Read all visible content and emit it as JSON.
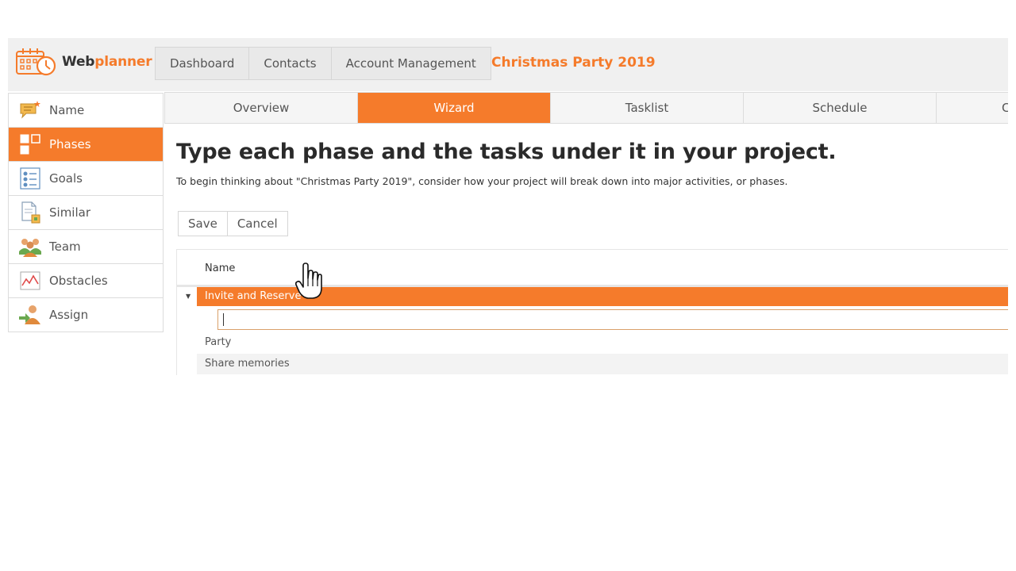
{
  "logo": {
    "text_part1": "Web",
    "text_part2": "planner"
  },
  "topnav": [
    "Dashboard",
    "Contacts",
    "Account Management"
  ],
  "project_title": "Christmas Party 2019",
  "sidebar": {
    "items": [
      {
        "label": "Name",
        "icon": "name-icon"
      },
      {
        "label": "Phases",
        "icon": "phases-icon",
        "active": true
      },
      {
        "label": "Goals",
        "icon": "goals-icon"
      },
      {
        "label": "Similar",
        "icon": "similar-icon"
      },
      {
        "label": "Team",
        "icon": "team-icon"
      },
      {
        "label": "Obstacles",
        "icon": "obstacles-icon"
      },
      {
        "label": "Assign",
        "icon": "assign-icon"
      }
    ]
  },
  "tabs": [
    "Overview",
    "Wizard",
    "Tasklist",
    "Schedule",
    "C"
  ],
  "active_tab": "Wizard",
  "main": {
    "heading": "Type each phase and the tasks under it in your project.",
    "subtext": "To begin thinking about \"Christmas Party 2019\", consider how your project will break down into major activities, or phases.",
    "save_label": "Save",
    "cancel_label": "Cancel"
  },
  "grid": {
    "column_name": "Name",
    "phases": [
      {
        "name": "Invite and Reserve",
        "expanded": true
      },
      {
        "name": "Party"
      },
      {
        "name": "Share memories"
      }
    ],
    "edit_value": ""
  },
  "colors": {
    "accent": "#f57b2b",
    "header_bg": "#f0f0f0"
  }
}
